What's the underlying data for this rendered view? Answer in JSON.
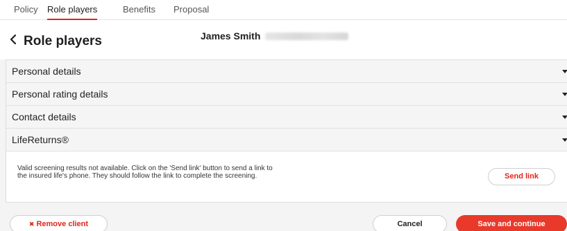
{
  "tabs": [
    {
      "label": "Policy"
    },
    {
      "label": "Role players"
    },
    {
      "label": "Benefits"
    },
    {
      "label": "Proposal"
    }
  ],
  "header": {
    "title": "Role players",
    "client_name": "James Smith"
  },
  "sections": [
    {
      "label": "Personal details"
    },
    {
      "label": "Personal rating details"
    },
    {
      "label": "Contact details"
    },
    {
      "label": "LifeReturns®"
    }
  ],
  "lifereturns": {
    "message": "Valid screening results not available. Click on the 'Send link' button to send a link to the insured life's phone. They should follow the link to complete the screening.",
    "send_link_label": "Send link"
  },
  "footer": {
    "remove_icon": "✖",
    "remove_label": "Remove client",
    "cancel_label": "Cancel",
    "save_label": "Save and continue"
  },
  "colors": {
    "accent": "#e0241b",
    "save_button": "#e8392b"
  }
}
